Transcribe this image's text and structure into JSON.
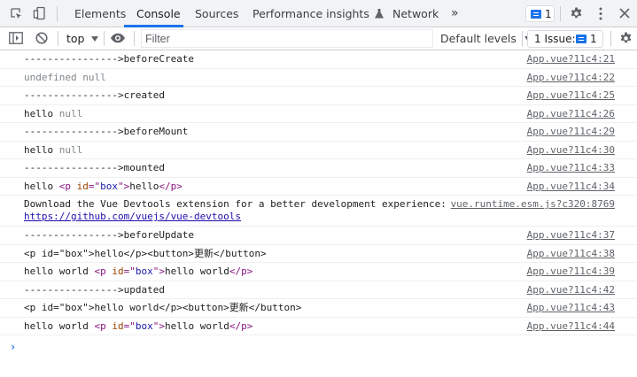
{
  "tabs": [
    {
      "label": "Elements"
    },
    {
      "label": "Console"
    },
    {
      "label": "Sources"
    },
    {
      "label": "Performance insights"
    },
    {
      "label": "Network"
    }
  ],
  "more_tabs": "»",
  "issues_count_top": "1",
  "toolbar": {
    "context": "top",
    "filter_placeholder": "Filter",
    "levels": "Default levels",
    "issues_label": "1 Issue:",
    "issues_count": "1"
  },
  "rows": [
    {
      "parts": [
        {
          "t": "---------------->beforeCreate",
          "c": ""
        }
      ],
      "src": "App.vue?11c4:21"
    },
    {
      "parts": [
        {
          "t": "undefined null",
          "c": "gray"
        }
      ],
      "src": "App.vue?11c4:22"
    },
    {
      "parts": [
        {
          "t": "---------------->created",
          "c": ""
        }
      ],
      "src": "App.vue?11c4:25"
    },
    {
      "parts": [
        {
          "t": "hello ",
          "c": ""
        },
        {
          "t": "null",
          "c": "gray"
        }
      ],
      "src": "App.vue?11c4:26"
    },
    {
      "parts": [
        {
          "t": "---------------->beforeMount",
          "c": ""
        }
      ],
      "src": "App.vue?11c4:29"
    },
    {
      "parts": [
        {
          "t": "hello ",
          "c": ""
        },
        {
          "t": "null",
          "c": "gray"
        }
      ],
      "src": "App.vue?11c4:30"
    },
    {
      "parts": [
        {
          "t": "---------------->mounted",
          "c": ""
        }
      ],
      "src": "App.vue?11c4:33"
    },
    {
      "parts": [
        {
          "t": "hello   ",
          "c": ""
        },
        {
          "t": "<p ",
          "c": "tagc"
        },
        {
          "t": "id",
          "c": "attr"
        },
        {
          "t": "=\"",
          "c": "tagc"
        },
        {
          "t": "box",
          "c": "val"
        },
        {
          "t": "\">",
          "c": "tagc"
        },
        {
          "t": "hello",
          "c": ""
        },
        {
          "t": "</p>",
          "c": "tagc"
        }
      ],
      "src": "App.vue?11c4:34"
    },
    {
      "parts": [
        {
          "t": "Download the Vue Devtools extension for a better development experience:",
          "c": ""
        }
      ],
      "link": "https://github.com/vuejs/vue-devtools",
      "src": "vue.runtime.esm.js?c320:8769",
      "tall": true
    },
    {
      "parts": [
        {
          "t": "---------------->beforeUpdate",
          "c": ""
        }
      ],
      "src": "App.vue?11c4:37"
    },
    {
      "parts": [
        {
          "t": "<p id=\"box\">hello</p><button>更新</button>",
          "c": ""
        }
      ],
      "src": "App.vue?11c4:38"
    },
    {
      "parts": [
        {
          "t": "hello world   ",
          "c": ""
        },
        {
          "t": "<p ",
          "c": "tagc"
        },
        {
          "t": "id",
          "c": "attr"
        },
        {
          "t": "=\"",
          "c": "tagc"
        },
        {
          "t": "box",
          "c": "val"
        },
        {
          "t": "\">",
          "c": "tagc"
        },
        {
          "t": "hello world",
          "c": ""
        },
        {
          "t": "</p>",
          "c": "tagc"
        }
      ],
      "src": "App.vue?11c4:39"
    },
    {
      "parts": [
        {
          "t": "---------------->updated",
          "c": ""
        }
      ],
      "src": "App.vue?11c4:42"
    },
    {
      "parts": [
        {
          "t": "<p id=\"box\">hello world</p><button>更新</button>",
          "c": ""
        }
      ],
      "src": "App.vue?11c4:43"
    },
    {
      "parts": [
        {
          "t": "hello world   ",
          "c": ""
        },
        {
          "t": "<p ",
          "c": "tagc"
        },
        {
          "t": "id",
          "c": "attr"
        },
        {
          "t": "=\"",
          "c": "tagc"
        },
        {
          "t": "box",
          "c": "val"
        },
        {
          "t": "\">",
          "c": "tagc"
        },
        {
          "t": "hello world",
          "c": ""
        },
        {
          "t": "</p>",
          "c": "tagc"
        }
      ],
      "src": "App.vue?11c4:44"
    }
  ],
  "colors": {
    "accent": "#1a73e8",
    "tag": "#881280",
    "attr": "#994500",
    "value": "#1a1aa6"
  }
}
